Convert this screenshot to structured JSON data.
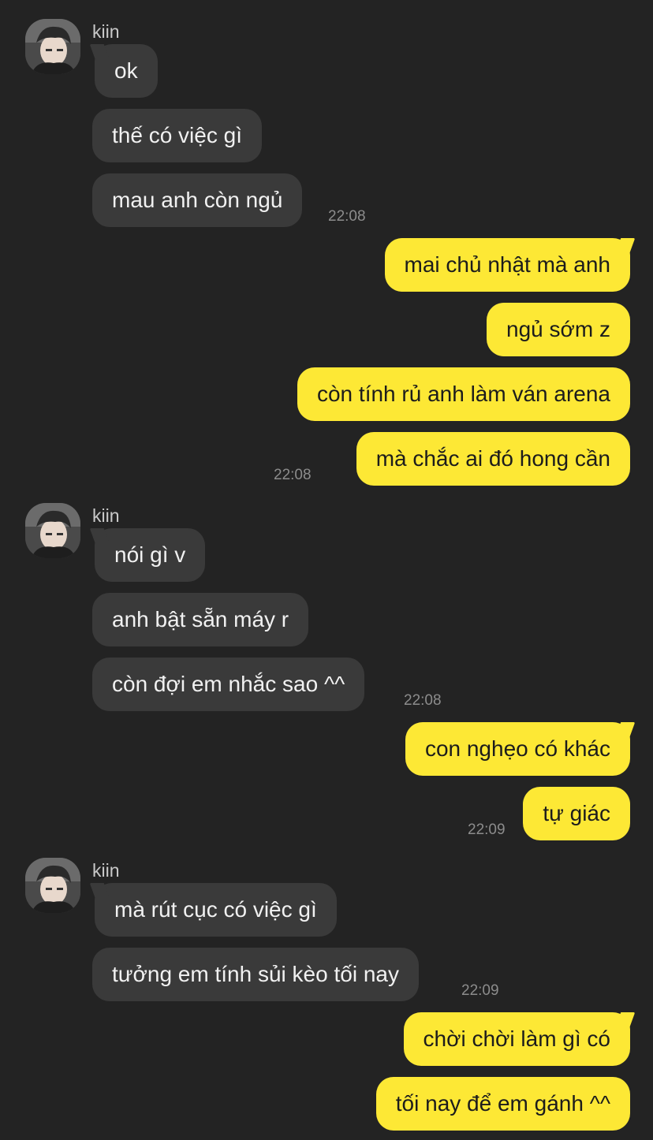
{
  "contact": {
    "name": "kiin"
  },
  "messages": [
    {
      "from": "kiin",
      "text": "ok"
    },
    {
      "from": "kiin",
      "text": "thế có việc gì"
    },
    {
      "from": "kiin",
      "text": "mau anh còn ngủ",
      "time": "22:08"
    },
    {
      "from": "me",
      "text": "mai chủ nhật mà anh"
    },
    {
      "from": "me",
      "text": "ngủ sớm z"
    },
    {
      "from": "me",
      "text": "còn tính rủ anh làm ván arena"
    },
    {
      "from": "me",
      "text": "mà chắc ai đó hong cần",
      "time": "22:08"
    },
    {
      "from": "kiin",
      "text": "nói gì v"
    },
    {
      "from": "kiin",
      "text": "anh bật sẵn máy r"
    },
    {
      "from": "kiin",
      "text": "còn đợi em nhắc sao ^^",
      "time": "22:08"
    },
    {
      "from": "me",
      "text": "con nghẹo có khác"
    },
    {
      "from": "me",
      "text": "tự giác",
      "time": "22:09"
    },
    {
      "from": "kiin",
      "text": "mà rút cục có việc gì"
    },
    {
      "from": "kiin",
      "text": "tưởng em tính sủi kèo tối nay",
      "time": "22:09"
    },
    {
      "from": "me",
      "text": "chời chời làm gì có"
    },
    {
      "from": "me",
      "text": "tối nay để em gánh ^^"
    }
  ],
  "colors": {
    "background": "#232323",
    "incoming_bubble": "#3a3a3a",
    "outgoing_bubble": "#fde835",
    "incoming_text": "#f1f1f1",
    "outgoing_text": "#1c1c1c",
    "timestamp": "#8c8c8c",
    "sender_name": "#c9c9c9"
  }
}
